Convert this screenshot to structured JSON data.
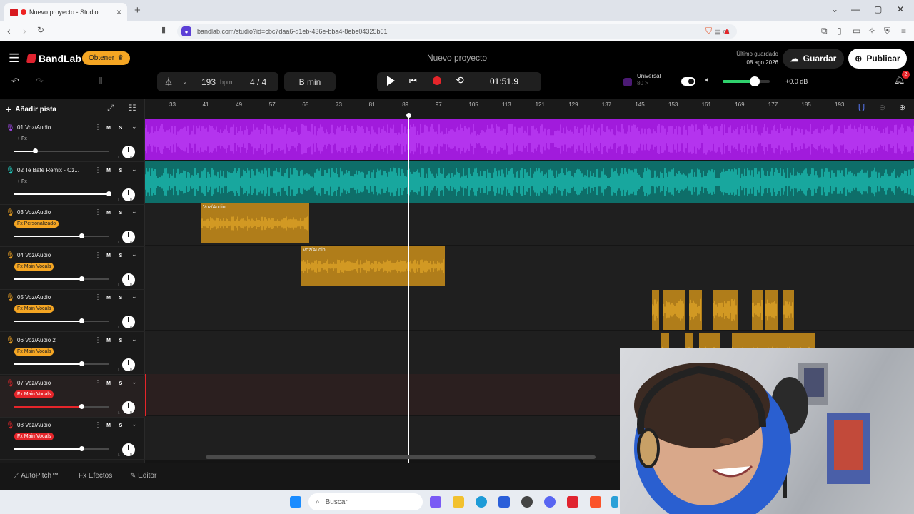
{
  "browser": {
    "tab_title": "Nuevo proyecto - Studio",
    "url": "bandlab.com/studio?id=cbc7daa6-d1eb-436e-bba4-8ebe04325b61"
  },
  "app": {
    "logo": "BandLab",
    "get_button": "Obtener",
    "project_title": "Nuevo proyecto",
    "last_saved_label": "Último guardado",
    "last_saved_date": "08 ago 2026",
    "save_button": "Guardar",
    "publish_button": "Publicar"
  },
  "toolbar": {
    "tempo": "193",
    "tempo_unit": "bpm",
    "time_signature": "4 / 4",
    "key": "B min",
    "time": "01:51.9",
    "preset_name": "Universal",
    "preset_sub": "80 >",
    "master_volume": "+0.0 dB",
    "volume_fraction": 0.68,
    "notification_count": "2"
  },
  "left": {
    "add_track": "Añadir pista"
  },
  "ruler": [
    "33",
    "41",
    "49",
    "57",
    "65",
    "73",
    "81",
    "89",
    "97",
    "105",
    "113",
    "121",
    "129",
    "137",
    "145",
    "153",
    "161",
    "169",
    "177",
    "185",
    "193"
  ],
  "tracks": [
    {
      "name": "01  Voz/Audio",
      "fx": "+ Fx",
      "fx_color": "#1a1a1a",
      "fx_text": "#ccc",
      "icon_color": "#b04cff",
      "fader": 0.22,
      "fader_color": "#fff"
    },
    {
      "name": "02  Te Baté Remix - Oz...",
      "fx": "+ Fx",
      "fx_color": "#1a1a1a",
      "fx_text": "#ccc",
      "icon_color": "#23d5c8",
      "fader": 1.0,
      "fader_color": "#fff"
    },
    {
      "name": "03  Voz/Audio",
      "fx": "Fx Personalizado",
      "fx_color": "#f5a623",
      "fx_text": "#222",
      "icon_color": "#f5a623",
      "fader": 0.71,
      "fader_color": "#fff"
    },
    {
      "name": "04  Voz/Audio",
      "fx": "Fx Main Vocals",
      "fx_color": "#f5a623",
      "fx_text": "#222",
      "icon_color": "#f5a623",
      "fader": 0.71,
      "fader_color": "#fff"
    },
    {
      "name": "05  Voz/Audio",
      "fx": "Fx Main Vocals",
      "fx_color": "#f5a623",
      "fx_text": "#222",
      "icon_color": "#f5a623",
      "fader": 0.71,
      "fader_color": "#fff"
    },
    {
      "name": "06  Voz/Audio 2",
      "fx": "Fx Main Vocals",
      "fx_color": "#f5a623",
      "fx_text": "#222",
      "icon_color": "#f5a623",
      "fader": 0.71,
      "fader_color": "#fff"
    },
    {
      "name": "07  Voz/Audio",
      "fx": "Fx Main Vocals",
      "fx_color": "#e5252a",
      "fx_text": "#fff",
      "icon_color": "#e5252a",
      "fader": 0.71,
      "fader_color": "#e5252a"
    },
    {
      "name": "08  Voz/Audio",
      "fx": "Fx Main Vocals",
      "fx_color": "#e5252a",
      "fx_text": "#fff",
      "icon_color": "#e5252a",
      "fader": 0.71,
      "fader_color": "#fff"
    }
  ],
  "clips": {
    "clip3_label": "Voz/Audio",
    "clip4_label": "Voz/Audio"
  },
  "bottom": {
    "autopitch": "AutoPitch™",
    "effects": "Efectos",
    "editor": "Editor"
  },
  "taskbar": {
    "search": "Buscar"
  }
}
